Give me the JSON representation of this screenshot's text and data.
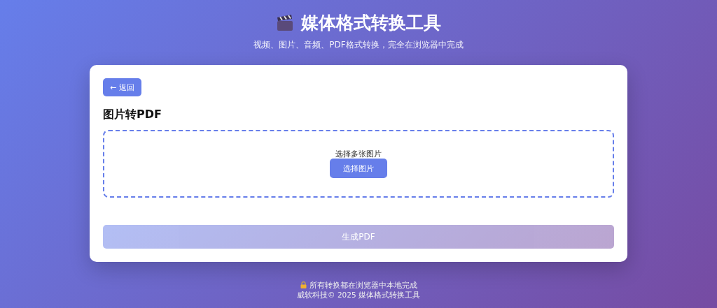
{
  "header": {
    "title": "媒体格式转换工具",
    "subtitle": "视频、图片、音频、PDF格式转换，完全在浏览器中完成"
  },
  "card": {
    "back_button": "← 返回",
    "heading": "图片转PDF",
    "dropzone": {
      "label": "选择多张图片",
      "button": "选择图片"
    },
    "generate_button": {
      "label": "生成PDF",
      "disabled": true
    }
  },
  "footer": {
    "note": "所有转换都在浏览器中本地完成",
    "copyright": "威软科技© 2025 媒体格式转换工具"
  }
}
